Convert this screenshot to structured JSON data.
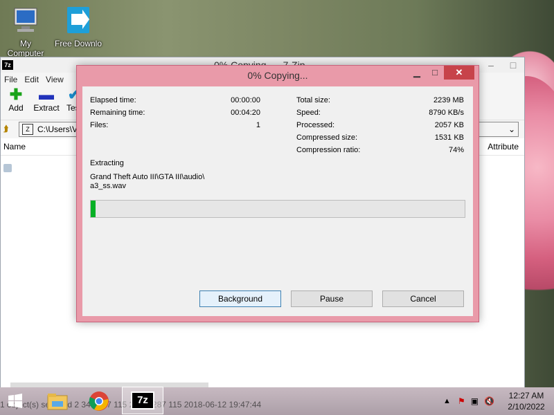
{
  "desktop": {
    "icons": [
      {
        "label": "My Computer",
        "icon": "computer-icon"
      },
      {
        "label": "Free Downlo",
        "icon": "download-icon"
      }
    ]
  },
  "app": {
    "title": "0% Copying... - 7-Zip",
    "menu": [
      "File",
      "Edit",
      "View"
    ],
    "toolbar": [
      {
        "label": "Add",
        "icon": "add-icon"
      },
      {
        "label": "Extract",
        "icon": "extract-icon"
      },
      {
        "label": "Test",
        "icon": "test-icon"
      }
    ],
    "address": "C:\\Users\\V",
    "columns": {
      "name": "Name",
      "attributes": "Attribute"
    }
  },
  "dialog": {
    "title": "0% Copying...",
    "stats_left": [
      {
        "label": "Elapsed time:",
        "value": "00:00:00"
      },
      {
        "label": "Remaining time:",
        "value": "00:04:20"
      },
      {
        "label": "Files:",
        "value": "1"
      }
    ],
    "stats_right": [
      {
        "label": "Total size:",
        "value": "2239 MB"
      },
      {
        "label": "Speed:",
        "value": "8790 KB/s"
      },
      {
        "label": "Processed:",
        "value": "2057 KB"
      },
      {
        "label": "Compressed size:",
        "value": "1531 KB"
      },
      {
        "label": "Compression ratio:",
        "value": "74%"
      }
    ],
    "status": "Extracting",
    "file_line1": "Grand Theft Auto III\\GTA III\\audio\\",
    "file_line2": "a3_ss.wav",
    "progress_percent": 0,
    "buttons": {
      "background": "Background",
      "pause": "Pause",
      "cancel": "Cancel"
    }
  },
  "taskbar": {
    "status_row": "1 object(s) selected    2 348 287 115    2 348 287 115    2018-06-12 19:47:44",
    "apps": [
      "windows-start-icon",
      "file-explorer-icon",
      "chrome-icon",
      "7zip-icon"
    ],
    "clock_time": "12:27 AM",
    "clock_date": "2/10/2022"
  }
}
